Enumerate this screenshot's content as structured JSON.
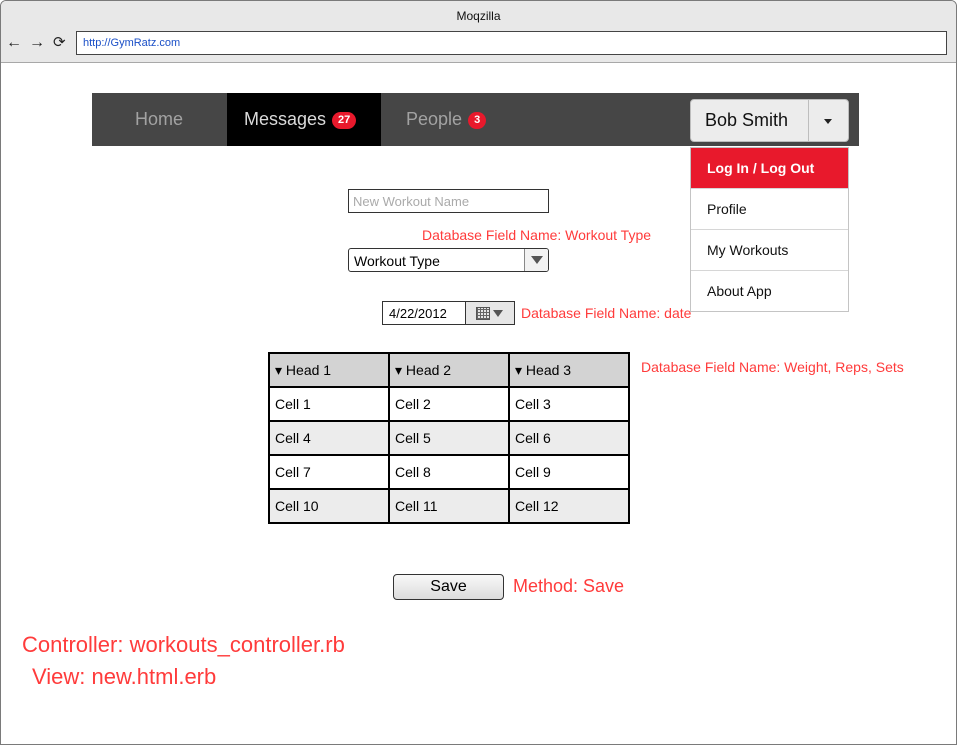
{
  "browser": {
    "title": "Moqzilla",
    "url": "http://GymRatz.com",
    "back_icon": "←",
    "forward_icon": "→",
    "reload_icon": "⟳"
  },
  "navbar": {
    "home": "Home",
    "messages": "Messages",
    "messages_count": "27",
    "people": "People",
    "people_count": "3",
    "user": "Bob Smith"
  },
  "user_menu": {
    "items": [
      "Log In / Log Out",
      "Profile",
      "My Workouts",
      "About App"
    ]
  },
  "form": {
    "workout_name_placeholder": "New Workout Name",
    "type_note": "Database Field Name: Workout Type",
    "workout_type": "Workout Type",
    "date": "4/22/2012",
    "date_note": "Database Field Name: date"
  },
  "table": {
    "headers": [
      "▾ Head 1",
      "▾ Head 2",
      "▾ Head 3"
    ],
    "rows": [
      [
        "Cell 1",
        "Cell 2",
        "Cell 3"
      ],
      [
        "Cell 4",
        "Cell 5",
        "Cell 6"
      ],
      [
        "Cell 7",
        "Cell 8",
        "Cell 9"
      ],
      [
        "Cell 10",
        "Cell 11",
        "Cell 12"
      ]
    ],
    "note": "Database Field Name: Weight, Reps, Sets"
  },
  "save": {
    "label": "Save",
    "note": "Method: Save"
  },
  "annotations": {
    "controller": "Controller: workouts_controller.rb",
    "view": "View: new.html.erb"
  },
  "colors": {
    "accent_red": "#e8192c",
    "note_red": "#ff3b3b",
    "navbar_bg": "#464646"
  }
}
